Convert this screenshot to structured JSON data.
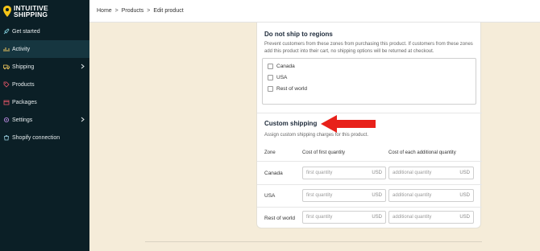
{
  "app": {
    "logo_line1": "INTUITIVE",
    "logo_line2": "SHIPPING"
  },
  "sidebar": {
    "items": [
      {
        "label": "Get started",
        "icon": "rocket-icon",
        "active": false
      },
      {
        "label": "Activity",
        "icon": "chart-icon",
        "active": true
      },
      {
        "label": "Shipping",
        "icon": "truck-icon",
        "active": false,
        "has_children": true
      },
      {
        "label": "Products",
        "icon": "tag-icon",
        "active": false
      },
      {
        "label": "Packages",
        "icon": "box-icon",
        "active": false
      },
      {
        "label": "Settings",
        "icon": "gear-icon",
        "active": false,
        "has_children": true
      },
      {
        "label": "Shopify connection",
        "icon": "shopify-icon",
        "active": false
      }
    ]
  },
  "breadcrumb": {
    "home": "Home",
    "products": "Products",
    "current": "Edit product",
    "separator": ">"
  },
  "do_not_ship": {
    "title": "Do not ship to regions",
    "description": "Prevent customers from these zones from purchasing this product. If customers from these zones add this product into their cart, no shipping options will be returned at checkout.",
    "regions": [
      {
        "label": "Canada",
        "checked": false
      },
      {
        "label": "USA",
        "checked": false
      },
      {
        "label": "Rest of world",
        "checked": false
      }
    ]
  },
  "custom_shipping": {
    "title": "Custom shipping",
    "description": "Assign custom shipping charges for this product.",
    "columns": {
      "zone": "Zone",
      "first": "Cost of first quantity",
      "additional": "Cost of each additional quantity"
    },
    "rows": [
      {
        "zone": "Canada",
        "first_placeholder": "first quantity",
        "additional_placeholder": "additional quantity",
        "currency": "USD"
      },
      {
        "zone": "USA",
        "first_placeholder": "first quantity",
        "additional_placeholder": "additional quantity",
        "currency": "USD"
      },
      {
        "zone": "Rest of world",
        "first_placeholder": "first quantity",
        "additional_placeholder": "additional quantity",
        "currency": "USD"
      }
    ]
  },
  "colors": {
    "sidebar_bg": "#0b1f26",
    "page_bg": "#f5ecd9",
    "logo_accent": "#f5c518",
    "arrow": "#e8211a"
  }
}
